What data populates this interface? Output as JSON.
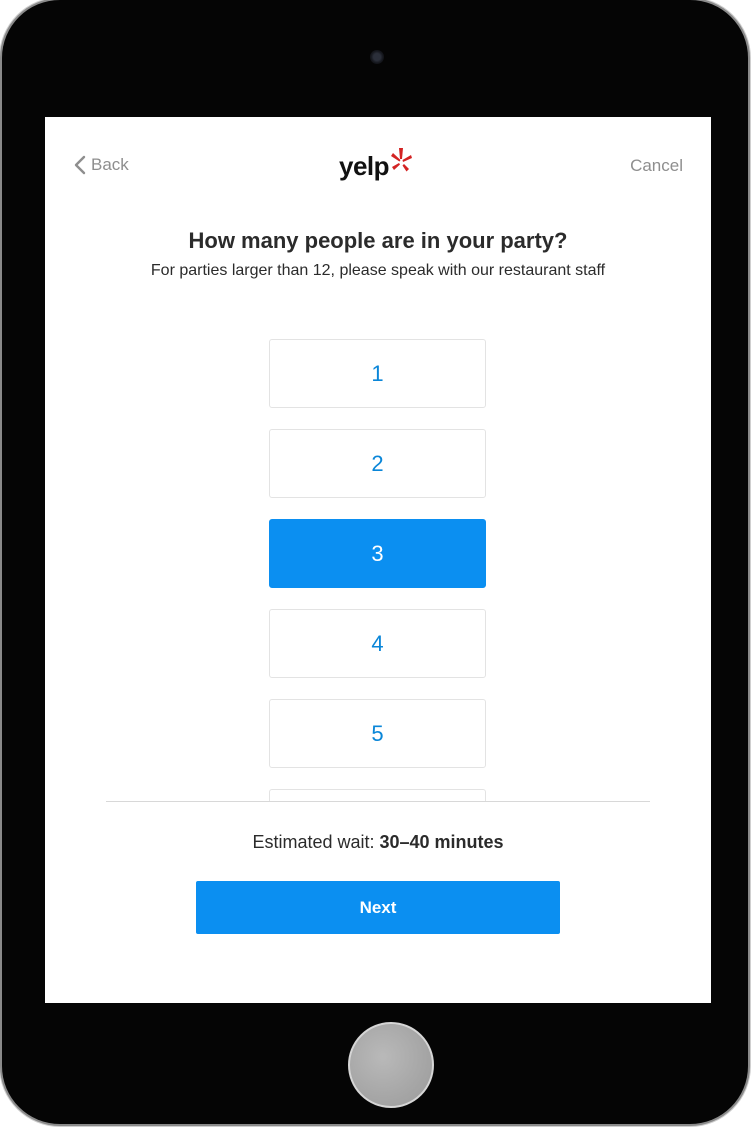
{
  "header": {
    "back_label": "Back",
    "cancel_label": "Cancel",
    "logo_text": "yelp",
    "logo_icon": "yelp-burst-icon",
    "brand_color": "#d32323"
  },
  "question": {
    "title": "How many people are in your party?",
    "subtitle": "For parties larger than 12, please speak with our restaurant staff"
  },
  "party_options": [
    {
      "label": "1",
      "selected": false
    },
    {
      "label": "2",
      "selected": false
    },
    {
      "label": "3",
      "selected": true
    },
    {
      "label": "4",
      "selected": false
    },
    {
      "label": "5",
      "selected": false
    },
    {
      "label": "",
      "selected": false
    }
  ],
  "footer": {
    "wait_prefix": "Estimated wait: ",
    "wait_value": "30–40 minutes",
    "next_label": "Next"
  },
  "colors": {
    "accent": "#0b8ff1",
    "option_text": "#0a86d8",
    "muted_text": "#8e8e8e"
  }
}
